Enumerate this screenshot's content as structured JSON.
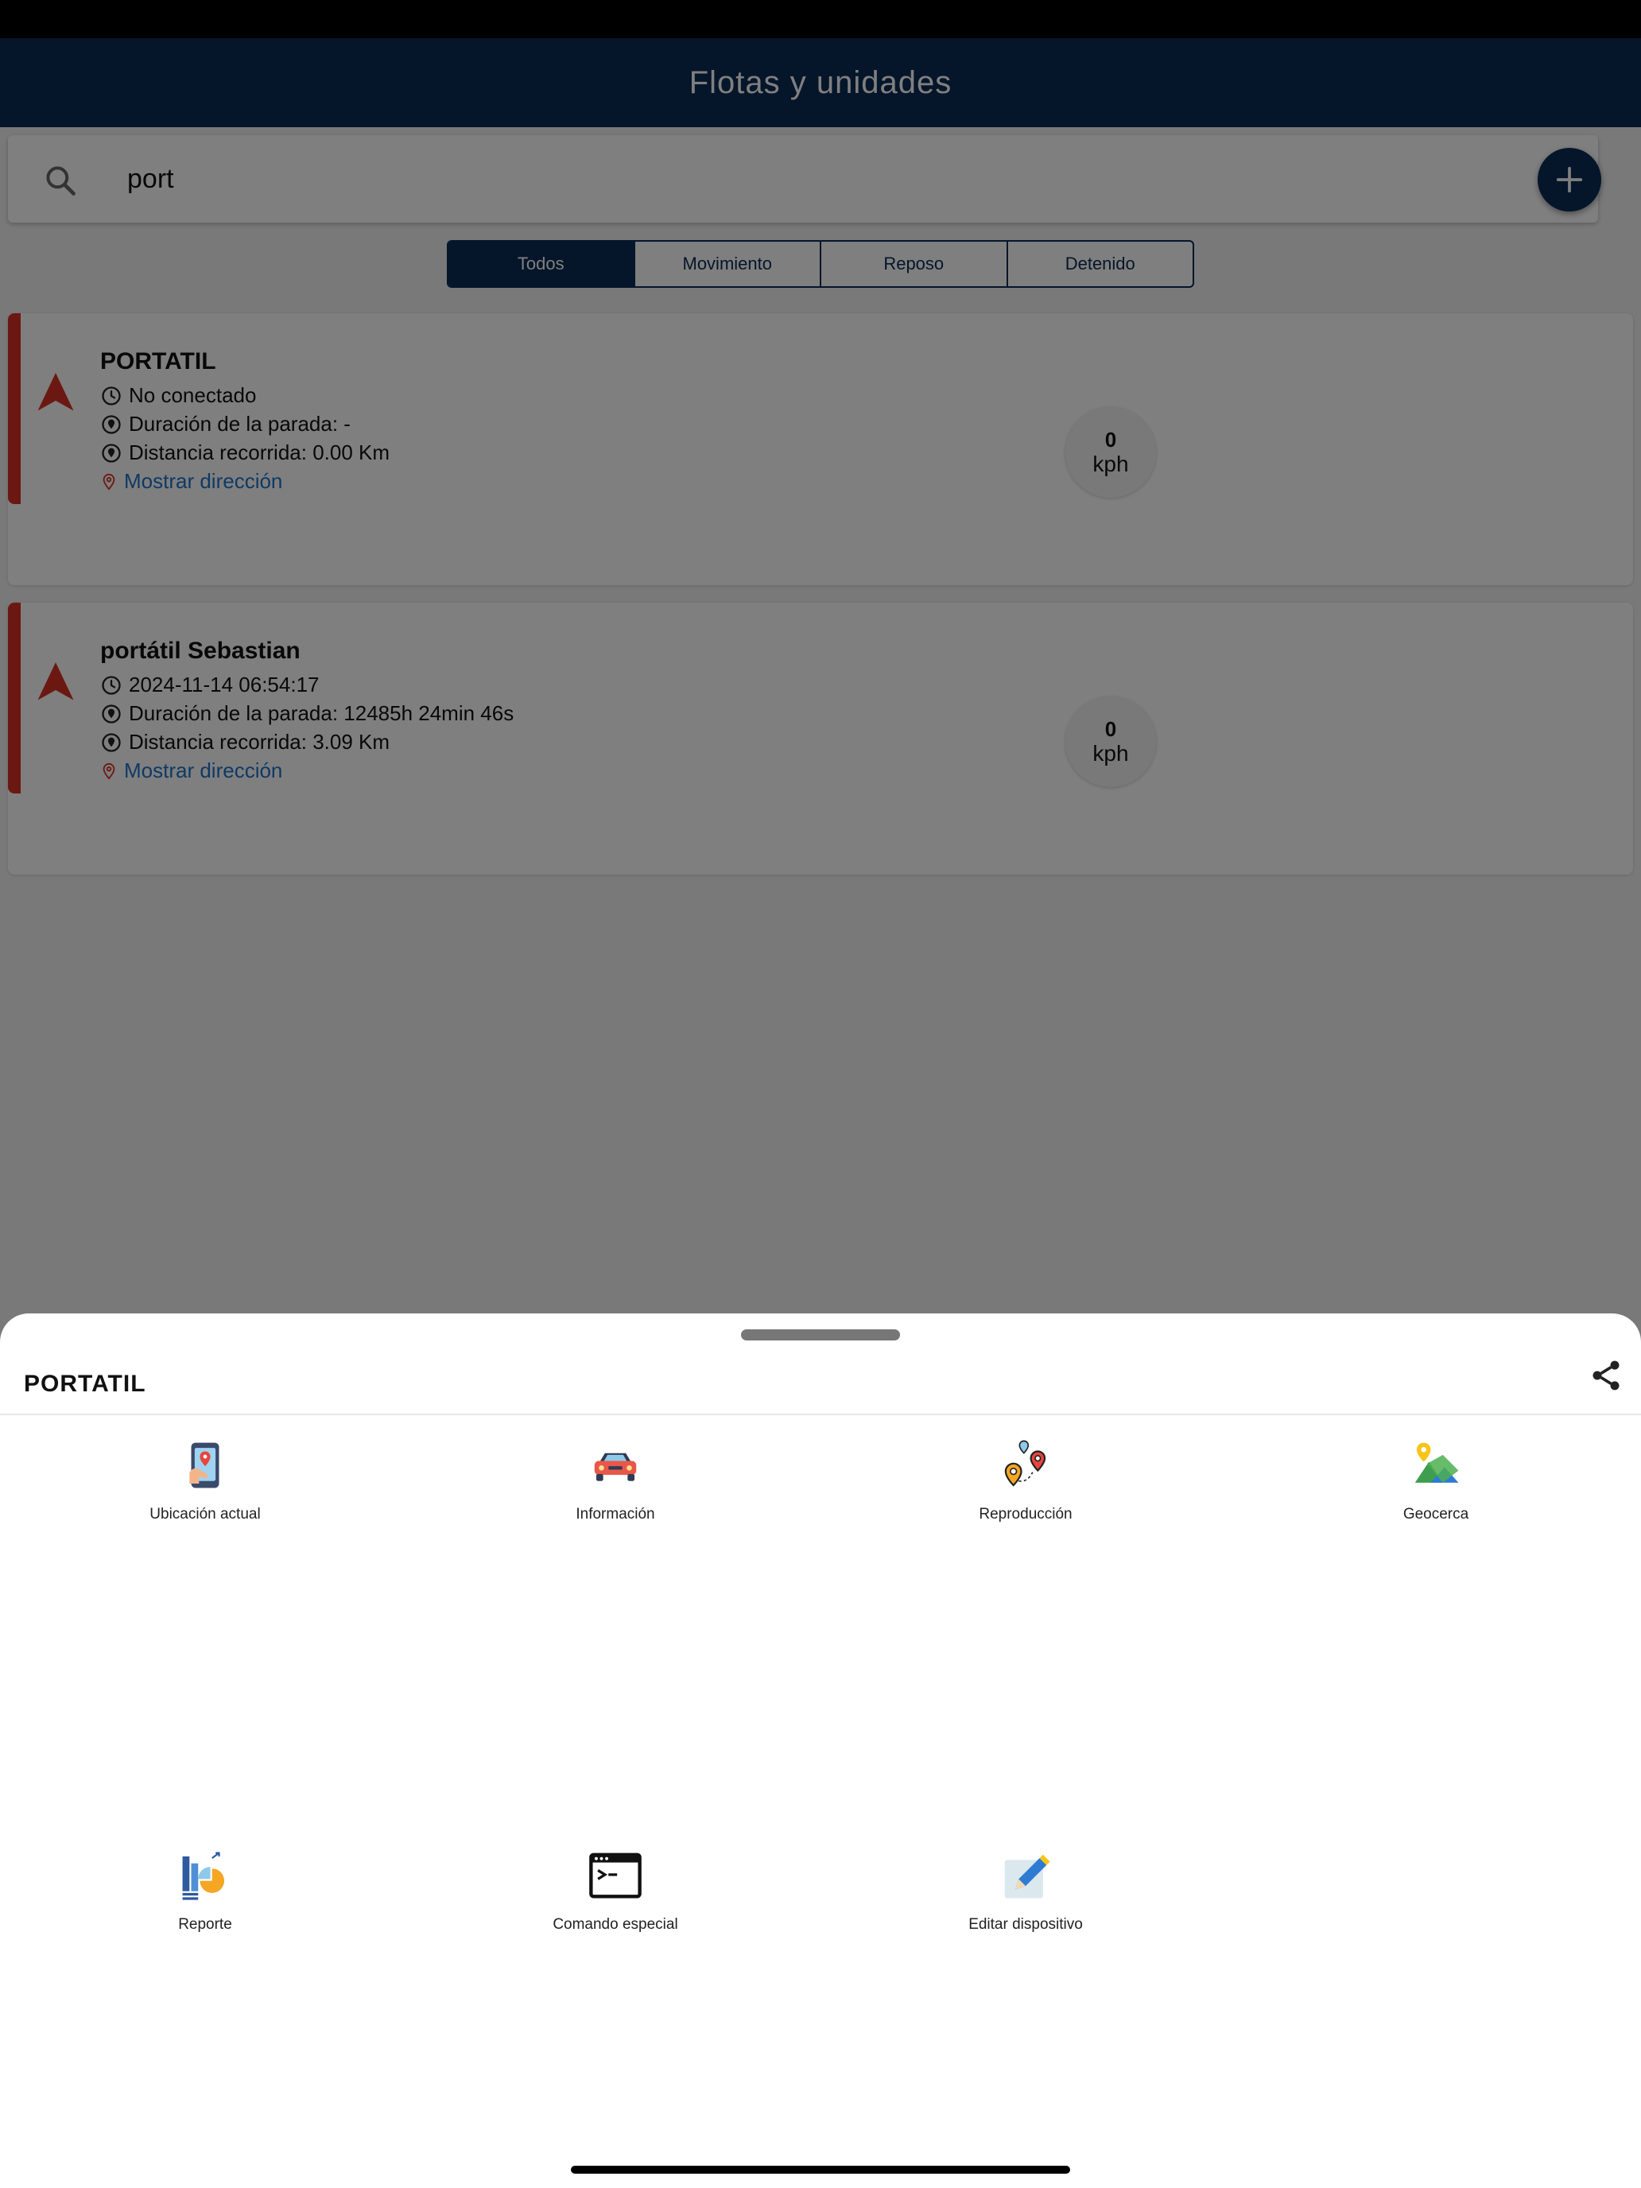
{
  "header": {
    "title": "Flotas y unidades"
  },
  "search": {
    "value": "port"
  },
  "filters": [
    {
      "label": "Todos",
      "active": true
    },
    {
      "label": "Movimiento",
      "active": false
    },
    {
      "label": "Reposo",
      "active": false
    },
    {
      "label": "Detenido",
      "active": false
    }
  ],
  "units": [
    {
      "name": "PORTATIL",
      "time": "No conectado",
      "stop_duration": "Duración de la parada: -",
      "distance": "Distancia recorrida: 0.00 Km",
      "address_link": "Mostrar dirección",
      "speed_value": "0",
      "speed_unit": "kph"
    },
    {
      "name": "portátil Sebastian",
      "time": "2024-11-14 06:54:17",
      "stop_duration": "Duración de la parada: 12485h 24min 46s",
      "distance": "Distancia recorrida: 3.09 Km",
      "address_link": "Mostrar dirección",
      "speed_value": "0",
      "speed_unit": "kph"
    }
  ],
  "sheet": {
    "title": "PORTATIL",
    "actions": [
      {
        "label": "Ubicación actual",
        "icon": "current-location-icon"
      },
      {
        "label": "Información",
        "icon": "car-icon"
      },
      {
        "label": "Reproducción",
        "icon": "route-playback-icon"
      },
      {
        "label": "Geocerca",
        "icon": "geofence-icon"
      },
      {
        "label": "Reporte",
        "icon": "report-chart-icon"
      },
      {
        "label": "Comando especial",
        "icon": "terminal-icon"
      },
      {
        "label": "Editar dispositivo",
        "icon": "edit-pencil-icon"
      }
    ]
  },
  "colors": {
    "primary": "#0b2a55",
    "status_offline": "#d93025",
    "link": "#1e73c8"
  }
}
